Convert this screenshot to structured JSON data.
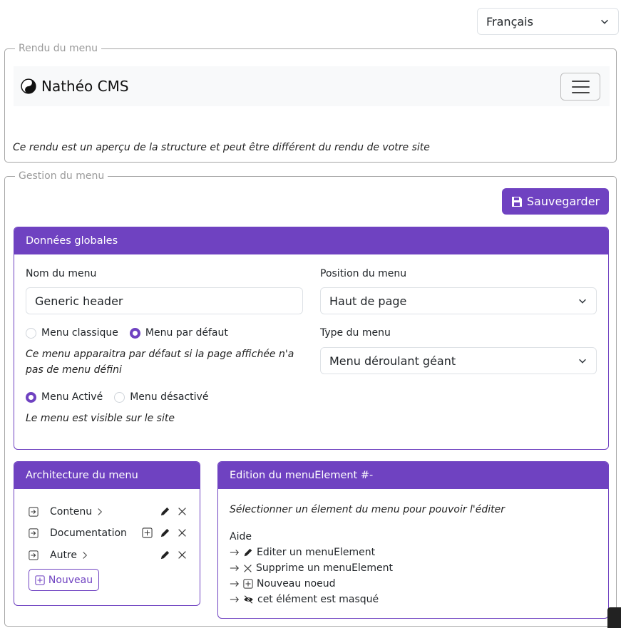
{
  "language_select": {
    "value": "Français"
  },
  "rendu": {
    "legend": "Rendu du menu",
    "brand": "Nathéo CMS",
    "note": "Ce rendu est un aperçu de la structure et peut être différent du rendu de votre site"
  },
  "gestion": {
    "legend": "Gestion du menu",
    "save_label": "Sauvegarder",
    "global": {
      "header": "Données globales",
      "name_label": "Nom du menu",
      "name_value": "Generic header",
      "position_label": "Position du menu",
      "position_value": "Haut de page",
      "type_label": "Type du menu",
      "type_value": "Menu déroulant géant",
      "radio_classique": "Menu classique",
      "radio_defaut": "Menu par défaut",
      "defaut_note_1": "Ce menu apparaitra par défaut si la page affichée n'a",
      "defaut_note_2": "pas de menu défini",
      "radio_active": "Menu Activé",
      "radio_desactive": "Menu désactivé",
      "active_note": "Le menu est visible sur le site"
    },
    "archi": {
      "header": "Architecture du menu",
      "items": [
        {
          "label": "Contenu"
        },
        {
          "label": "Documentation"
        },
        {
          "label": "Autre"
        }
      ],
      "new_label": "Nouveau"
    },
    "edit": {
      "header": "Edition du menuElement #-",
      "hint": "Sélectionner un élement du menu pour pouvoir l'éditer",
      "aide": "Aide",
      "help": [
        "Editer un menuElement",
        "Supprime un menuElement",
        "Nouveau noeud",
        "cet élément est masqué"
      ]
    }
  },
  "colors": {
    "accent": "#6f42c1"
  }
}
